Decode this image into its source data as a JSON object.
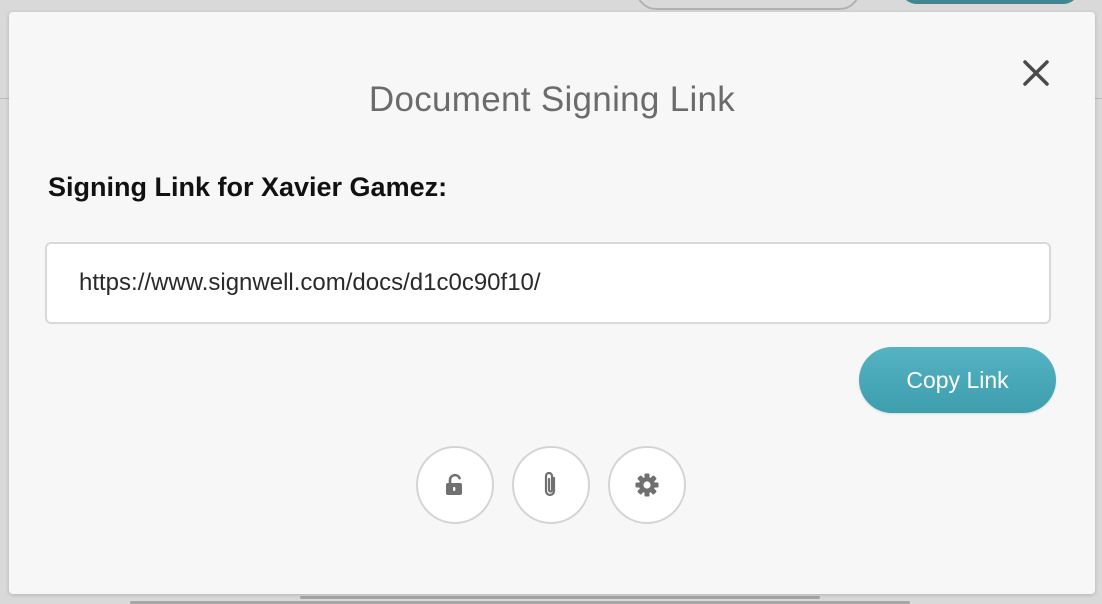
{
  "modal": {
    "title": "Document Signing Link",
    "label": "Signing Link for Xavier Gamez:",
    "link_value": "https://www.signwell.com/docs/d1c0c90f10/",
    "copy_button_label": "Copy Link",
    "close_icon": "close-icon"
  },
  "actions": [
    {
      "icon": "unlock-icon"
    },
    {
      "icon": "paperclip-icon"
    },
    {
      "icon": "gear-icon"
    }
  ],
  "colors": {
    "accent": "#4aa9b8",
    "title_text": "#6b6b6b",
    "icon_gray": "#707070"
  }
}
